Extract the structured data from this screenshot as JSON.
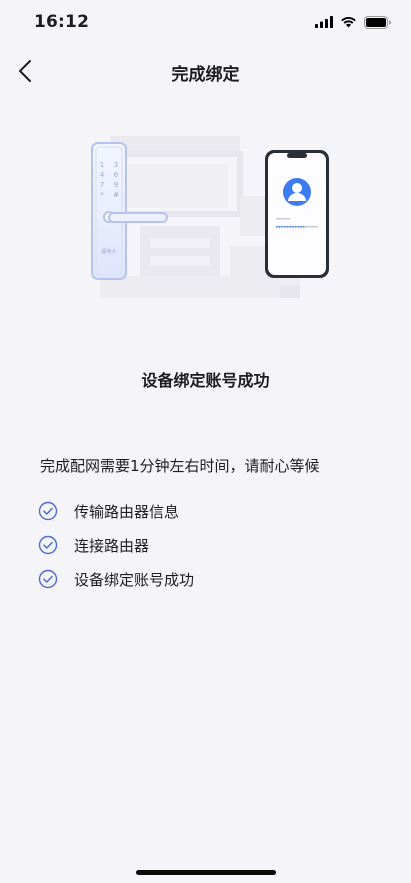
{
  "status_bar": {
    "time": "16:12"
  },
  "nav": {
    "title": "完成绑定",
    "back_icon": "chevron-left-icon"
  },
  "illustration": {
    "lock_brand": "超米大"
  },
  "result": {
    "title": "设备绑定账号成功"
  },
  "hint": "完成配网需要1分钟左右时间，请耐心等候",
  "steps": [
    {
      "label": "传输路由器信息",
      "status": "done"
    },
    {
      "label": "连接路由器",
      "status": "done"
    },
    {
      "label": "设备绑定账号成功",
      "status": "done"
    }
  ],
  "colors": {
    "accent": "#4a6cd4",
    "background": "#f5f5f9"
  }
}
